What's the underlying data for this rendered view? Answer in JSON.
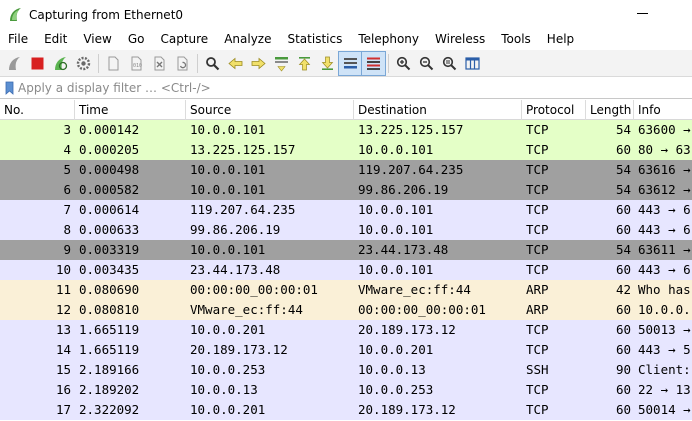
{
  "window": {
    "title": "Capturing from Ethernet0"
  },
  "menu": [
    "File",
    "Edit",
    "View",
    "Go",
    "Capture",
    "Analyze",
    "Statistics",
    "Telephony",
    "Wireless",
    "Tools",
    "Help"
  ],
  "filter": {
    "placeholder": "Apply a display filter … <Ctrl-/>"
  },
  "columns": [
    "No.",
    "Time",
    "Source",
    "Destination",
    "Protocol",
    "Length",
    "Info"
  ],
  "colors": {
    "tcp": "#e7e6ff",
    "tcp_syn": "#e4ffc7",
    "tcp_bad": "#a0a0a0",
    "arp": "#faf0d7",
    "accent_green": "#5bb450"
  },
  "packets": [
    {
      "no": "3",
      "time": "0.000142",
      "source": "10.0.0.101",
      "destination": "13.225.125.157",
      "protocol": "TCP",
      "length": "54",
      "info": "63600 → 80",
      "color": "#e4ffc7"
    },
    {
      "no": "4",
      "time": "0.000205",
      "source": "13.225.125.157",
      "destination": "10.0.0.101",
      "protocol": "TCP",
      "length": "60",
      "info": "80 → 63",
      "color": "#e4ffc7"
    },
    {
      "no": "5",
      "time": "0.000498",
      "source": "10.0.0.101",
      "destination": "119.207.64.235",
      "protocol": "TCP",
      "length": "54",
      "info": "63616 →",
      "color": "#a0a0a0"
    },
    {
      "no": "6",
      "time": "0.000582",
      "source": "10.0.0.101",
      "destination": "99.86.206.19",
      "protocol": "TCP",
      "length": "54",
      "info": "63612 →",
      "color": "#a0a0a0"
    },
    {
      "no": "7",
      "time": "0.000614",
      "source": "119.207.64.235",
      "destination": "10.0.0.101",
      "protocol": "TCP",
      "length": "60",
      "info": "443 → 6",
      "color": "#e7e6ff"
    },
    {
      "no": "8",
      "time": "0.000633",
      "source": "99.86.206.19",
      "destination": "10.0.0.101",
      "protocol": "TCP",
      "length": "60",
      "info": "443 → 6",
      "color": "#e7e6ff"
    },
    {
      "no": "9",
      "time": "0.003319",
      "source": "10.0.0.101",
      "destination": "23.44.173.48",
      "protocol": "TCP",
      "length": "54",
      "info": "63611 →",
      "color": "#a0a0a0"
    },
    {
      "no": "10",
      "time": "0.003435",
      "source": "23.44.173.48",
      "destination": "10.0.0.101",
      "protocol": "TCP",
      "length": "60",
      "info": "443 → 6",
      "color": "#e7e6ff"
    },
    {
      "no": "11",
      "time": "0.080690",
      "source": "00:00:00_00:00:01",
      "destination": "VMware_ec:ff:44",
      "protocol": "ARP",
      "length": "42",
      "info": "Who has",
      "color": "#faf0d7"
    },
    {
      "no": "12",
      "time": "0.080810",
      "source": "VMware_ec:ff:44",
      "destination": "00:00:00_00:00:01",
      "protocol": "ARP",
      "length": "60",
      "info": "10.0.0.",
      "color": "#faf0d7"
    },
    {
      "no": "13",
      "time": "1.665119",
      "source": "10.0.0.201",
      "destination": "20.189.173.12",
      "protocol": "TCP",
      "length": "60",
      "info": "50013 →",
      "color": "#e7e6ff"
    },
    {
      "no": "14",
      "time": "1.665119",
      "source": "20.189.173.12",
      "destination": "10.0.0.201",
      "protocol": "TCP",
      "length": "60",
      "info": "443 → 5",
      "color": "#e7e6ff"
    },
    {
      "no": "15",
      "time": "2.189166",
      "source": "10.0.0.253",
      "destination": "10.0.0.13",
      "protocol": "SSH",
      "length": "90",
      "info": "Client:",
      "color": "#e7e6ff"
    },
    {
      "no": "16",
      "time": "2.189202",
      "source": "10.0.0.13",
      "destination": "10.0.0.253",
      "protocol": "TCP",
      "length": "60",
      "info": "22 → 13",
      "color": "#e7e6ff"
    },
    {
      "no": "17",
      "time": "2.322092",
      "source": "10.0.0.201",
      "destination": "20.189.173.12",
      "protocol": "TCP",
      "length": "60",
      "info": "50014 →",
      "color": "#e7e6ff"
    }
  ]
}
